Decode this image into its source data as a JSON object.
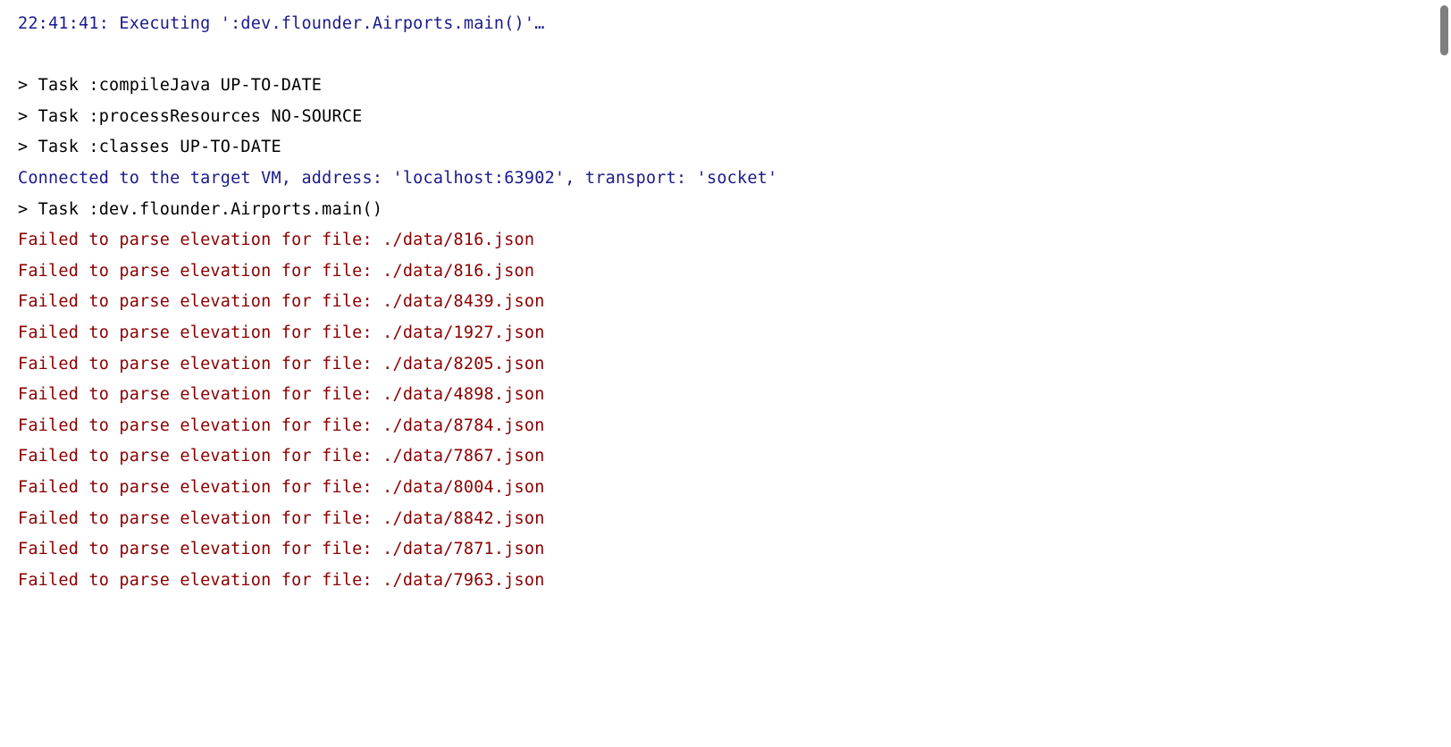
{
  "lines": [
    {
      "cls": "info",
      "text": "22:41:41: Executing ':dev.flounder.Airports.main()'…"
    },
    {
      "cls": "normal",
      "text": ""
    },
    {
      "cls": "normal",
      "text": "> Task :compileJava UP-TO-DATE"
    },
    {
      "cls": "normal",
      "text": "> Task :processResources NO-SOURCE"
    },
    {
      "cls": "normal",
      "text": "> Task :classes UP-TO-DATE"
    },
    {
      "cls": "info",
      "text": "Connected to the target VM, address: 'localhost:63902', transport: 'socket'"
    },
    {
      "cls": "normal",
      "text": "> Task :dev.flounder.Airports.main()"
    },
    {
      "cls": "error",
      "text": "Failed to parse elevation for file: ./data/816.json"
    },
    {
      "cls": "error",
      "text": "Failed to parse elevation for file: ./data/816.json"
    },
    {
      "cls": "error",
      "text": "Failed to parse elevation for file: ./data/8439.json"
    },
    {
      "cls": "error",
      "text": "Failed to parse elevation for file: ./data/1927.json"
    },
    {
      "cls": "error",
      "text": "Failed to parse elevation for file: ./data/8205.json"
    },
    {
      "cls": "error",
      "text": "Failed to parse elevation for file: ./data/4898.json"
    },
    {
      "cls": "error",
      "text": "Failed to parse elevation for file: ./data/8784.json"
    },
    {
      "cls": "error",
      "text": "Failed to parse elevation for file: ./data/7867.json"
    },
    {
      "cls": "error",
      "text": "Failed to parse elevation for file: ./data/8004.json"
    },
    {
      "cls": "error",
      "text": "Failed to parse elevation for file: ./data/8842.json"
    },
    {
      "cls": "error",
      "text": "Failed to parse elevation for file: ./data/7871.json"
    },
    {
      "cls": "error",
      "text": "Failed to parse elevation for file: ./data/7963.json"
    }
  ]
}
